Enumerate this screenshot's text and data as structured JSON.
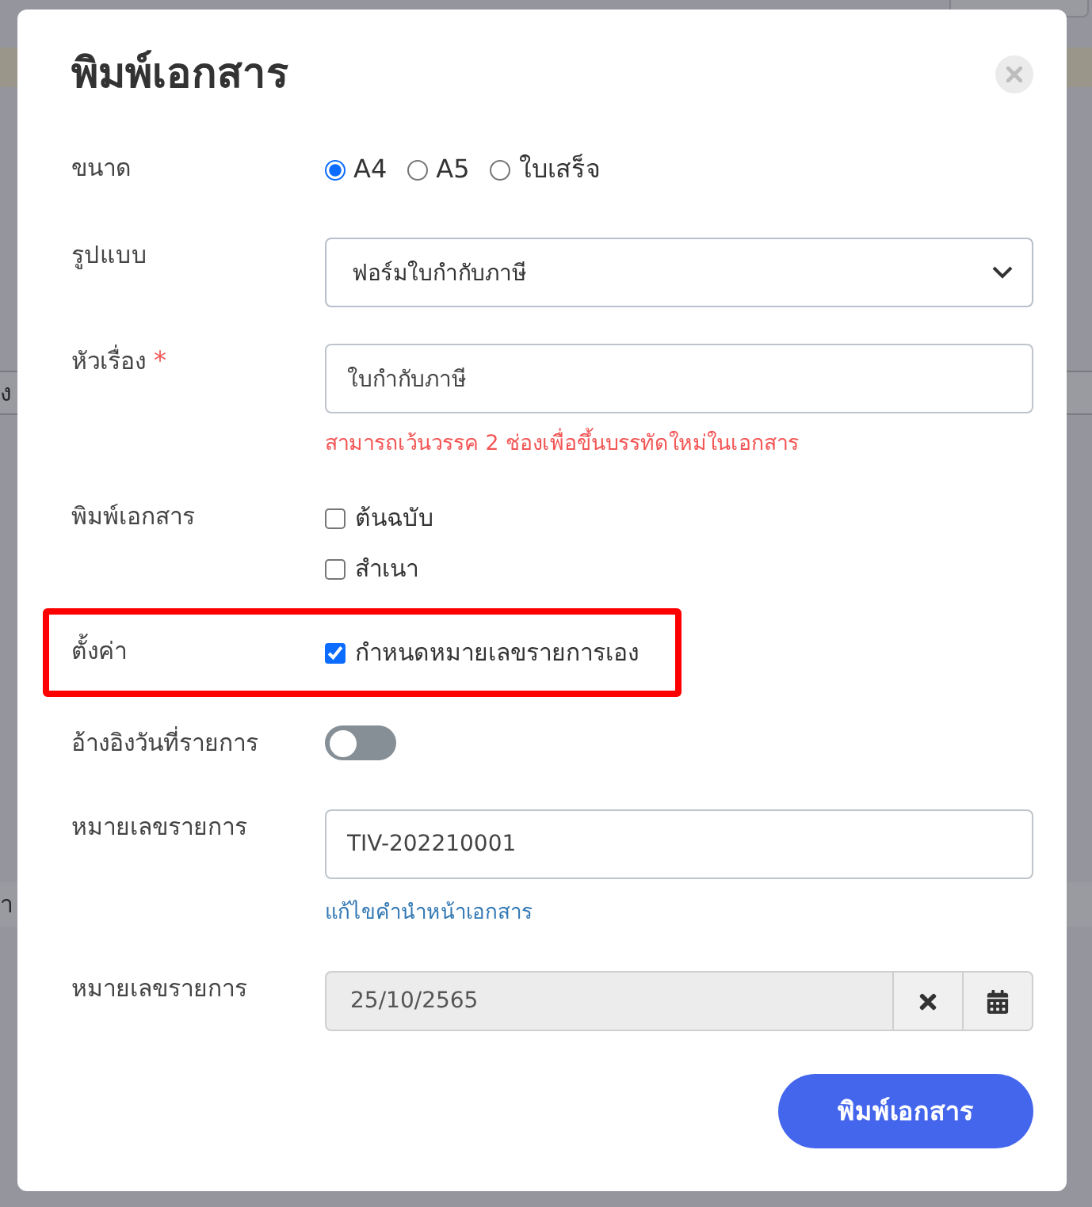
{
  "page_behind": {
    "fragments": [
      "ง",
      "า"
    ]
  },
  "dialog": {
    "title": "พิมพ์เอกสาร",
    "fields": [
      {
        "kind": "radio",
        "label": "ขนาด",
        "options": [
          {
            "label": "A4",
            "selected": true
          },
          {
            "label": "A5",
            "selected": false
          },
          {
            "label": "ใบเสร็จ",
            "selected": false
          }
        ]
      },
      {
        "kind": "select",
        "label": "รูปแบบ",
        "value": "ฟอร์มใบกำกับภาษี"
      },
      {
        "kind": "text",
        "label": "หัวเรื่อง",
        "required_mark": "*",
        "value": "ใบกำกับภาษี",
        "hint": "สามารถเว้นวรรค 2 ช่องเพื่อขึ้นบรรทัดใหม่ในเอกสาร"
      },
      {
        "kind": "checkbox",
        "label": "พิมพ์เอกสาร",
        "options": [
          {
            "label": "ต้นฉบับ",
            "checked": false
          },
          {
            "label": "สำเนา",
            "checked": false
          }
        ]
      },
      {
        "kind": "checkbox",
        "label": "ตั้งค่า",
        "highlighted": true,
        "options": [
          {
            "label": "กำหนดหมายเลขรายการเอง",
            "checked": true
          }
        ]
      },
      {
        "kind": "toggle",
        "label": "อ้างอิงวันที่รายการ",
        "on": false
      },
      {
        "kind": "text",
        "label": "หมายเลขรายการ",
        "value": "TIV-202210001",
        "link": "แก้ไขคำนำหน้าเอกสาร"
      },
      {
        "kind": "date",
        "label": "หมายเลขรายการ",
        "value": "25/10/2565",
        "disabled": true
      }
    ],
    "print_button": "พิมพ์เอกสาร"
  }
}
